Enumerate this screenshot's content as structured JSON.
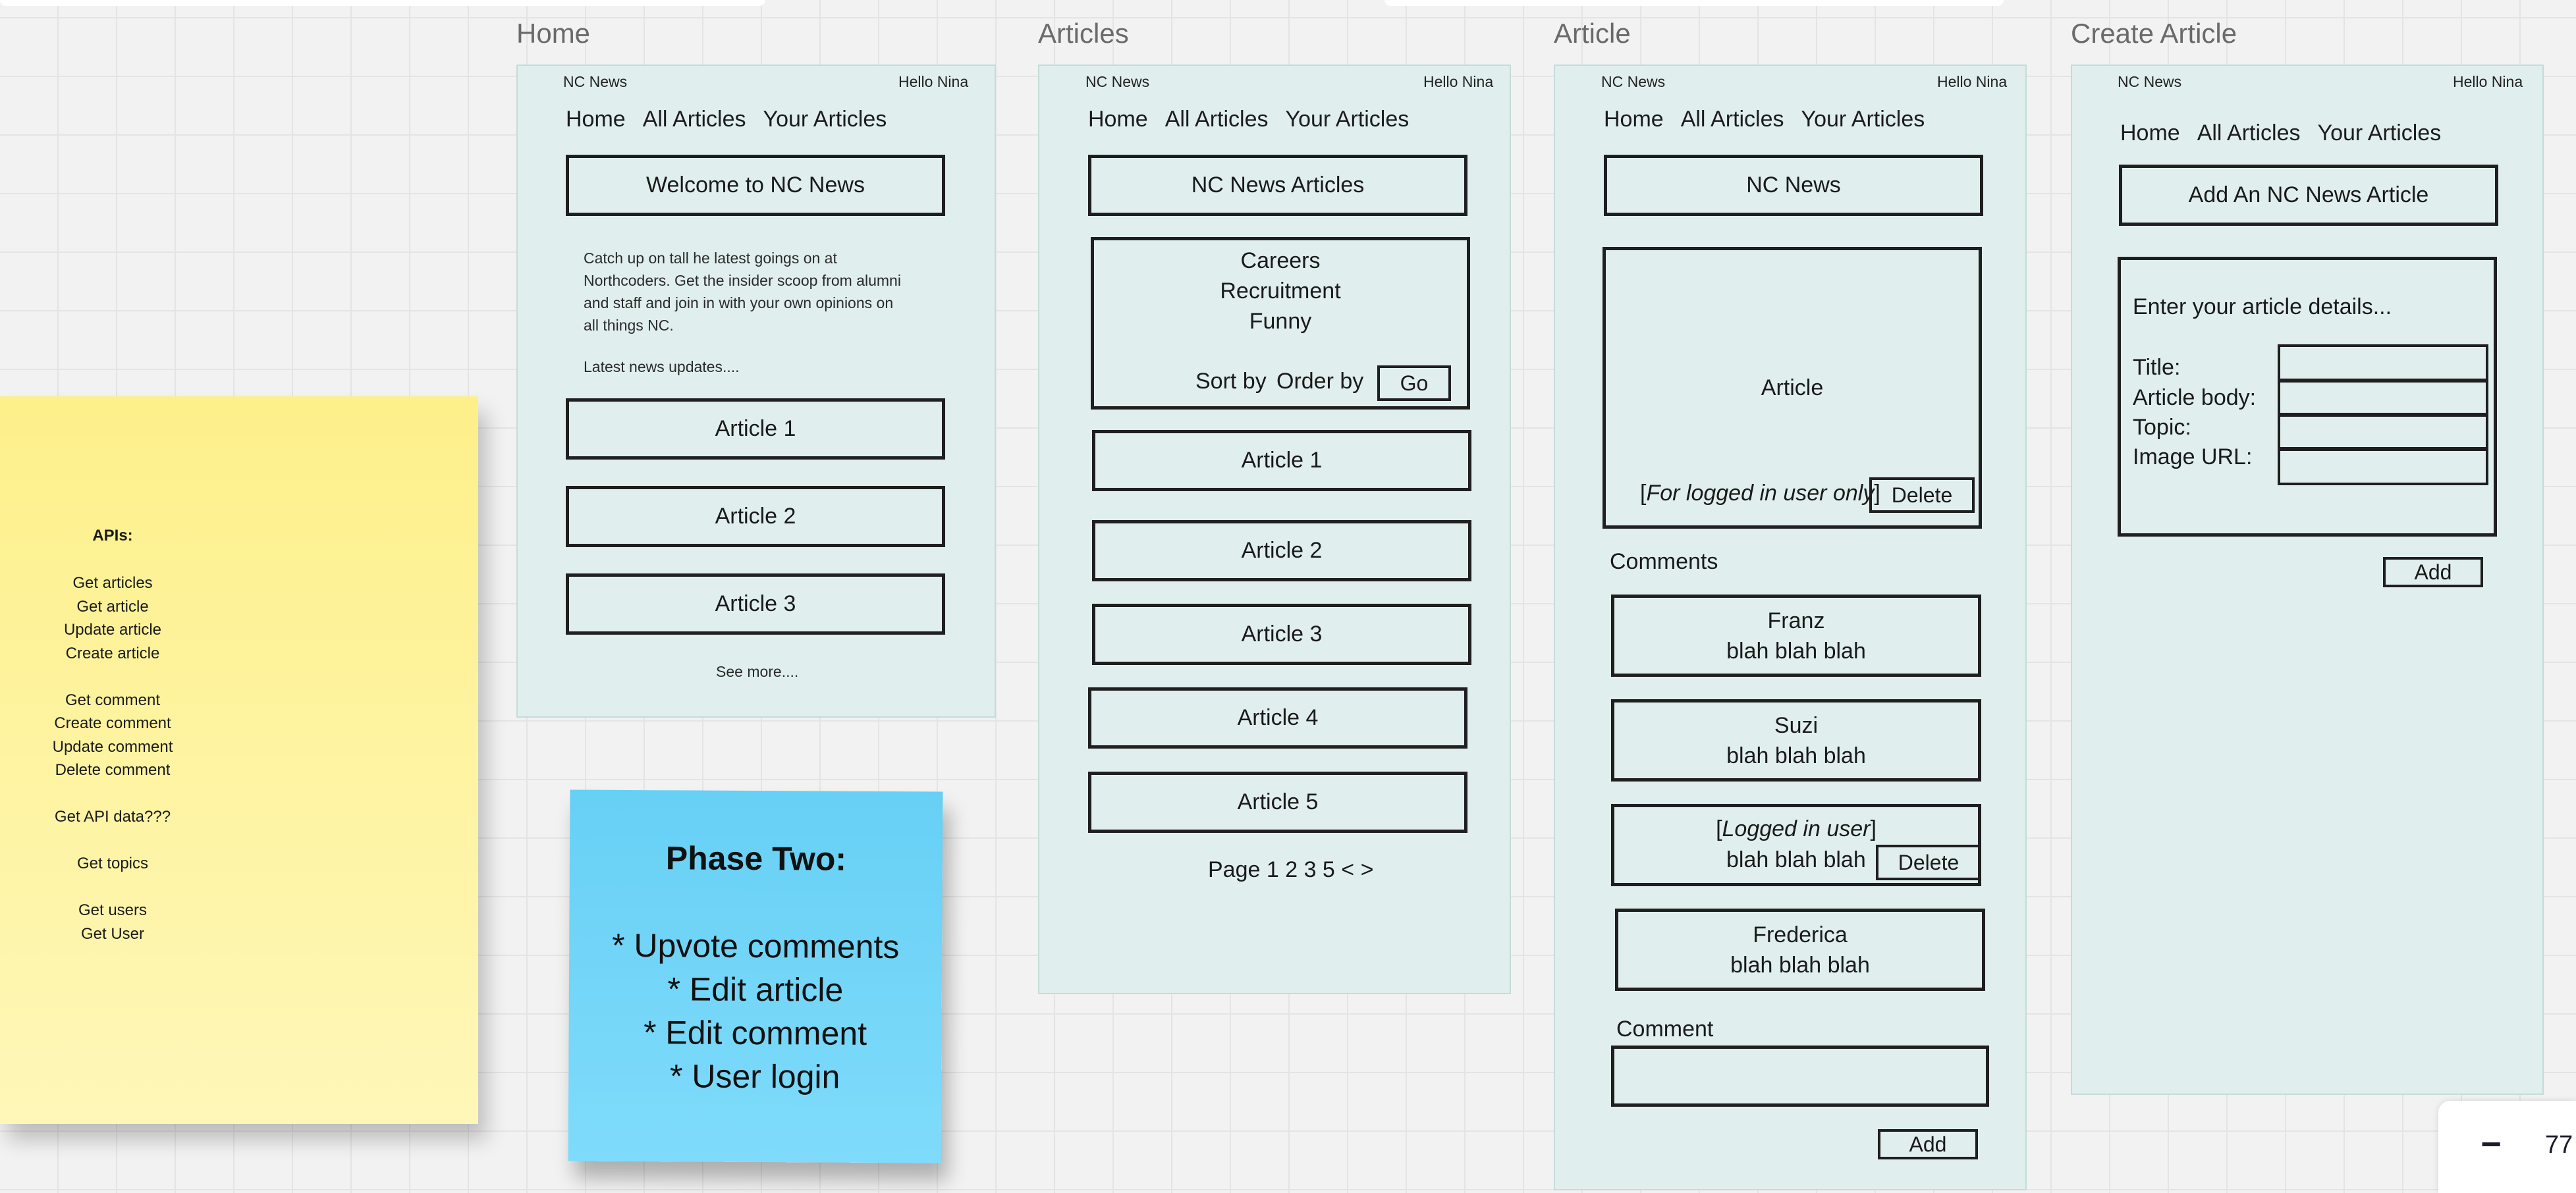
{
  "frames": {
    "home": {
      "title": "Home",
      "brand": "NC News",
      "greeting": "Hello Nina",
      "nav": [
        "Home",
        "All Articles",
        "Your Articles"
      ],
      "banner": "Welcome to NC News",
      "intro_lines": [
        "Catch up on tall he latest goings on at",
        "Northcoders. Get the insider scoop from alumni",
        "and staff and join in with your own opinions on",
        "all things NC."
      ],
      "latest": "Latest news updates....",
      "articles": [
        "Article 1",
        "Article 2",
        "Article 3"
      ],
      "see_more": "See more...."
    },
    "articles": {
      "title": "Articles",
      "brand": "NC News",
      "greeting": "Hello Nina",
      "nav": [
        "Home",
        "All Articles",
        "Your Articles"
      ],
      "banner": "NC News Articles",
      "topics": [
        "Careers",
        "Recruitment",
        "Funny"
      ],
      "sort_by": "Sort by",
      "order_by": "Order by",
      "go": "Go",
      "articles": [
        "Article 1",
        "Article 2",
        "Article 3",
        "Article 4",
        "Article 5"
      ],
      "pagination": "Page 1 2 3 5 < >"
    },
    "article": {
      "title": "Article",
      "brand": "NC News",
      "greeting": "Hello Nina",
      "nav": [
        "Home",
        "All Articles",
        "Your Articles"
      ],
      "banner": "NC News",
      "article_label": "Article",
      "logged_in_note_open": "[",
      "logged_in_note_italic": "For logged in user only",
      "logged_in_note_close": "]",
      "delete": "Delete",
      "comments_heading": "Comments",
      "comments": [
        {
          "author": "Franz",
          "body": "blah blah blah"
        },
        {
          "author": "Suzi",
          "body": "blah blah blah"
        },
        {
          "author_open": "[",
          "author_italic": "Logged in user",
          "author_close": "]",
          "body": "blah blah blah",
          "delete": "Delete"
        },
        {
          "author": "Frederica",
          "body": "blah blah blah"
        }
      ],
      "comment_label": "Comment",
      "add": "Add"
    },
    "create": {
      "title": "Create Article",
      "brand": "NC News",
      "greeting": "Hello Nina",
      "nav": [
        "Home",
        "All Articles",
        "Your Articles"
      ],
      "banner": "Add An NC News Article",
      "form_heading": "Enter your article details...",
      "fields": [
        "Title:",
        "Article body:",
        "Topic:",
        "Image URL:"
      ],
      "add": "Add"
    }
  },
  "sticky_apis": {
    "heading": "APIs:",
    "lines": [
      "Get articles",
      "Get article",
      "Update article",
      "Create article",
      "",
      "Get comment",
      "Create comment",
      "Update comment",
      "Delete comment",
      "",
      "Get API data???",
      "",
      "Get topics",
      "",
      "Get users",
      "Get User"
    ]
  },
  "sticky_phase_two": {
    "heading": "Phase Two:",
    "items": [
      "* Upvote comments",
      "* Edit article",
      "* Edit comment",
      "* User login"
    ]
  },
  "zoom": {
    "minus": "−",
    "value": "77"
  },
  "colors": {
    "board": "#f2f2f2",
    "frame_fill": "#e0efed",
    "sticky_yellow": "#fdf08a",
    "sticky_blue": "#67d0f5"
  }
}
